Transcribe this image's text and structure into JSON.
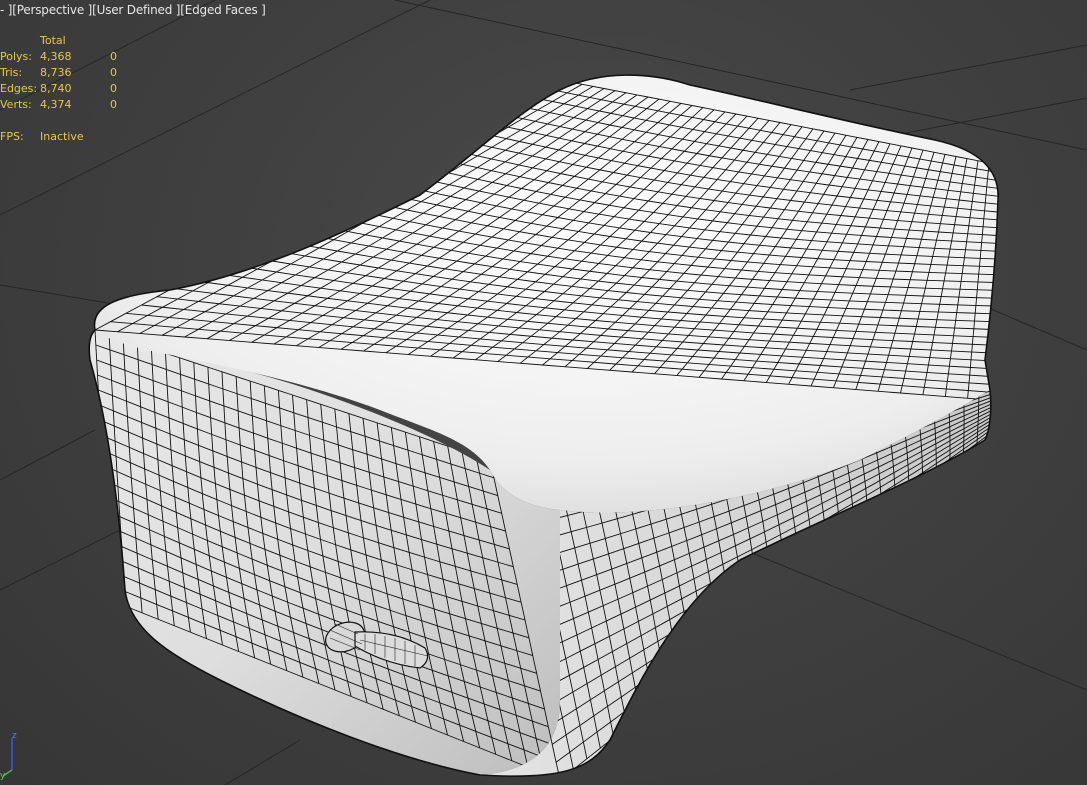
{
  "viewport": {
    "label_prefix": "- ]",
    "view_name": "[Perspective ]",
    "shading": "[User Defined ]",
    "display": "[Edged Faces ]"
  },
  "stats": {
    "header": "Total",
    "rows": [
      {
        "label": "Polys:",
        "total": "4,368",
        "selected": "0"
      },
      {
        "label": "Tris:",
        "total": "8,736",
        "selected": "0"
      },
      {
        "label": "Edges:",
        "total": "8,740",
        "selected": "0"
      },
      {
        "label": "Verts:",
        "total": "4,374",
        "selected": "0"
      }
    ],
    "fps_label": "FPS:",
    "fps_value": "Inactive"
  },
  "axis": {
    "z": "z",
    "y": "y"
  },
  "colors": {
    "background": "#404040",
    "grid": "#262626",
    "mesh": "#f0f0f0",
    "wire": "#111111",
    "stats_text": "#e8c84a",
    "label_text": "#e6e6e6"
  }
}
